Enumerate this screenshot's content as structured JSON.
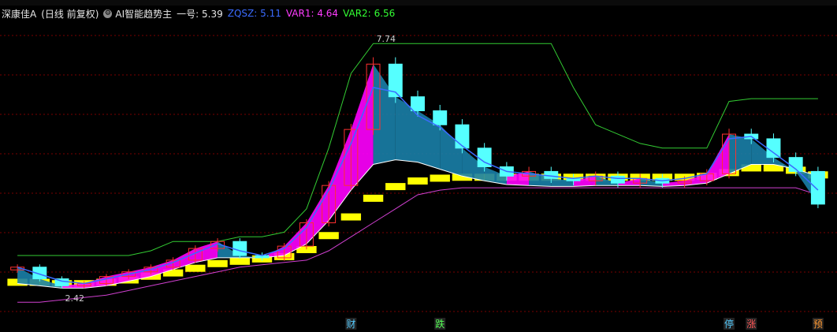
{
  "header": {
    "stock_name": "深康佳A",
    "period_info": "(日线 前复权)",
    "indicator_name": "AI智能趋势主",
    "values": [
      {
        "label": "一号:",
        "value": "5.39",
        "color": "#e6e6e6"
      },
      {
        "label": "ZQSZ:",
        "value": "5.11",
        "color": "#3a6bff"
      },
      {
        "label": "VAR1:",
        "value": "4.64",
        "color": "#ff3cff"
      },
      {
        "label": "VAR2:",
        "value": "6.56",
        "color": "#33ff33"
      }
    ]
  },
  "colors": {
    "grid": "#7a0000",
    "up": "#ff3030",
    "down": "#55ffff",
    "ma": "#3a6bff",
    "yellow": "#ffff00",
    "magenta": "#ff00ff",
    "teal": "#1a7fa8",
    "white": "#ffffff",
    "green_line": "#33cc33",
    "purple_line": "#d040d0"
  },
  "chart_data": {
    "type": "candlestick",
    "title": "深康佳A (日线 前复权)",
    "price_range": [
      2.0,
      8.2
    ],
    "annotations": [
      {
        "text": "7.74",
        "kind": "high",
        "index": 16
      },
      {
        "text": "2.42",
        "kind": "low",
        "index": 2
      }
    ],
    "signal_labels": [
      {
        "text": "财",
        "index": 15,
        "color": "#55ccff"
      },
      {
        "text": "跌",
        "index": 19,
        "color": "#55ff55"
      },
      {
        "text": "停",
        "index": 32,
        "color": "#55ccff"
      },
      {
        "text": "涨",
        "index": 33,
        "color": "#ff5555"
      },
      {
        "text": "预",
        "index": 36,
        "color": "#ff9933"
      }
    ],
    "close": [
      2.95,
      2.7,
      2.55,
      2.6,
      2.75,
      2.85,
      2.95,
      3.1,
      3.35,
      3.5,
      3.2,
      3.15,
      3.4,
      3.9,
      4.7,
      5.9,
      7.3,
      6.6,
      6.3,
      6.0,
      5.5,
      5.1,
      4.9,
      5.0,
      4.85,
      4.8,
      4.9,
      4.75,
      4.85,
      4.75,
      4.8,
      4.95,
      5.8,
      5.7,
      5.3,
      5.0,
      4.3
    ],
    "ma": [
      2.95,
      2.8,
      2.65,
      2.6,
      2.7,
      2.8,
      2.9,
      3.05,
      3.25,
      3.45,
      3.3,
      3.2,
      3.35,
      3.8,
      4.6,
      5.6,
      6.8,
      6.7,
      6.2,
      5.95,
      5.55,
      5.2,
      5.0,
      4.95,
      4.9,
      4.85,
      4.9,
      4.85,
      4.85,
      4.8,
      4.85,
      4.95,
      5.7,
      5.75,
      5.4,
      5.05,
      4.6
    ],
    "var1": [
      2.6,
      2.55,
      2.5,
      2.5,
      2.55,
      2.65,
      2.75,
      2.9,
      3.05,
      3.15,
      3.15,
      3.15,
      3.2,
      3.45,
      3.95,
      4.6,
      5.15,
      5.25,
      5.2,
      5.05,
      4.9,
      4.8,
      4.72,
      4.7,
      4.68,
      4.68,
      4.7,
      4.7,
      4.7,
      4.68,
      4.7,
      4.75,
      4.95,
      5.15,
      5.15,
      5.05,
      4.9
    ],
    "zqsz": [
      2.55,
      2.55,
      2.52,
      2.52,
      2.55,
      2.6,
      2.68,
      2.75,
      2.85,
      2.95,
      3.0,
      3.05,
      3.1,
      3.25,
      3.55,
      3.95,
      4.35,
      4.6,
      4.72,
      4.78,
      4.8,
      4.8,
      4.8,
      4.8,
      4.8,
      4.8,
      4.8,
      4.8,
      4.8,
      4.8,
      4.8,
      4.82,
      4.9,
      5.0,
      5.0,
      4.95,
      4.85
    ],
    "var2": [
      3.2,
      3.2,
      3.2,
      3.2,
      3.2,
      3.2,
      3.3,
      3.5,
      3.5,
      3.5,
      3.6,
      3.6,
      3.7,
      4.2,
      5.5,
      7.1,
      7.74,
      7.74,
      7.74,
      7.74,
      7.74,
      7.74,
      7.74,
      7.74,
      7.74,
      6.8,
      6.0,
      5.8,
      5.6,
      5.5,
      5.5,
      5.5,
      6.5,
      6.56,
      6.56,
      6.56,
      6.56
    ],
    "support_line": [
      2.2,
      2.2,
      2.25,
      2.3,
      2.35,
      2.45,
      2.55,
      2.65,
      2.75,
      2.85,
      2.95,
      3.0,
      3.05,
      3.1,
      3.3,
      3.6,
      3.9,
      4.2,
      4.5,
      4.6,
      4.65,
      4.65,
      4.65,
      4.65,
      4.65,
      4.65,
      4.65,
      4.65,
      4.65,
      4.65,
      4.65,
      4.65,
      4.65,
      4.65,
      4.65,
      4.65,
      4.5
    ],
    "ylim": [
      2.0,
      8.2
    ]
  }
}
